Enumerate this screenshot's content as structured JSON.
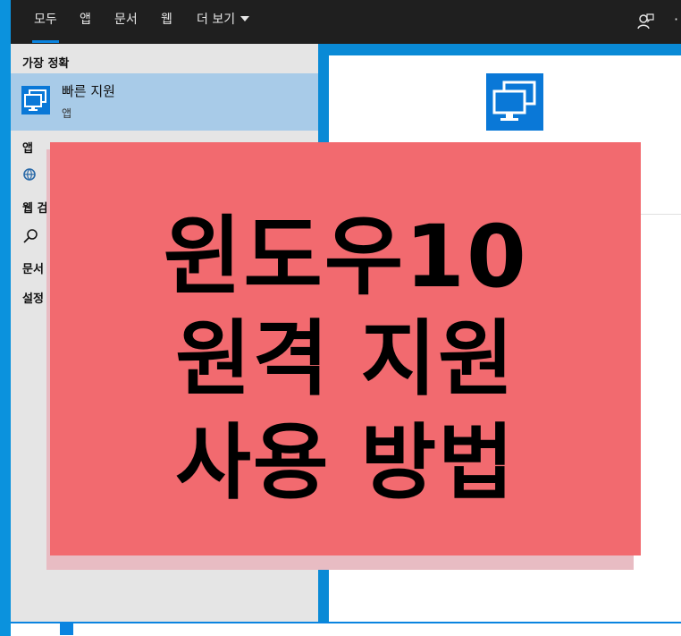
{
  "tabs": [
    "모두",
    "앱",
    "문서",
    "웹",
    "더 보기"
  ],
  "left_panel": {
    "best_match_heading": "가장 정확",
    "best_match": {
      "name": "빠른 지원",
      "type": "앱"
    },
    "apps_heading": "앱",
    "web_heading": "웹 검",
    "docs_heading": "문서",
    "settings_heading": "설정"
  },
  "overlay": {
    "line1": "윈도우10",
    "line2": "원격 지원",
    "line3": "사용 방법"
  },
  "colors": {
    "accent": "#0a78d7",
    "best_match_bg": "#a8cbe8",
    "overlay_bg": "#f26a6f",
    "topbar_bg": "#1f1f1f"
  },
  "icons": {
    "app_icon": "remote-monitor-icon",
    "web_icon": "globe-icon",
    "search_icon": "search-icon",
    "feedback_icon": "feedback-icon",
    "more_icon": "more-icon"
  }
}
